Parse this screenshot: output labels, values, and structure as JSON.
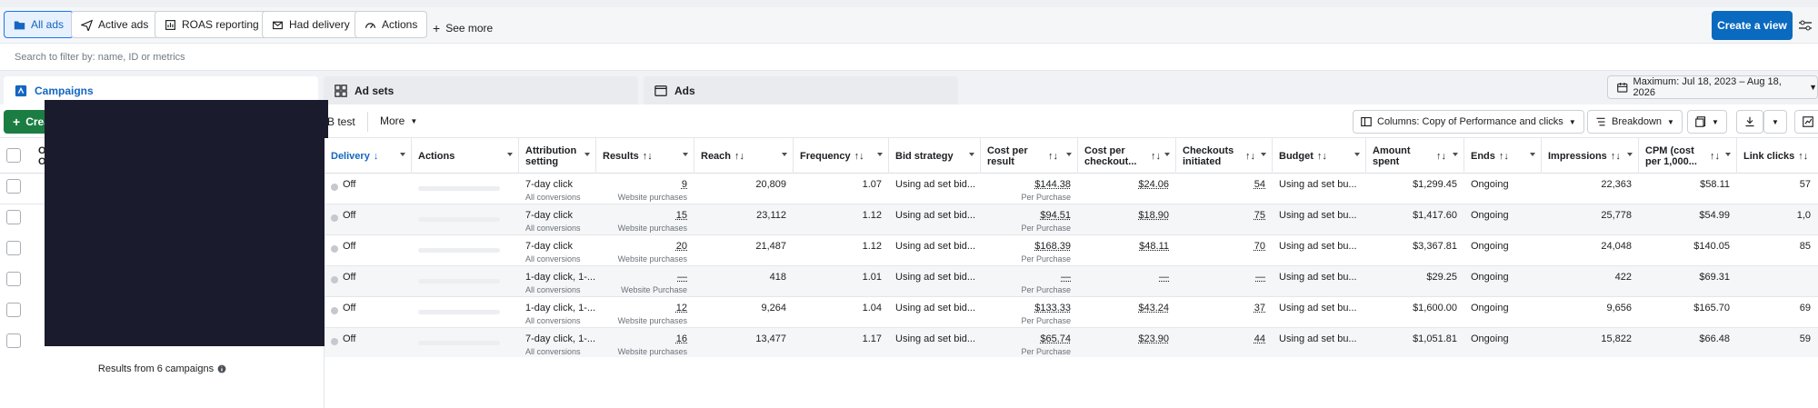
{
  "filters": {
    "chips": [
      {
        "label": "All ads",
        "icon": "folder-icon",
        "active": true
      },
      {
        "label": "Active ads",
        "icon": "send-icon",
        "active": false
      },
      {
        "label": "ROAS reporting",
        "icon": "report-icon",
        "active": false
      },
      {
        "label": "Had delivery",
        "icon": "inbox-icon",
        "active": false
      },
      {
        "label": "Actions",
        "icon": "gauge-icon",
        "active": false
      }
    ],
    "see_more": "See more",
    "create_view": "Create a view"
  },
  "search": {
    "placeholder": "Search to filter by: name, ID or metrics"
  },
  "tabs": {
    "campaigns": "Campaigns",
    "ad_sets": "Ad sets",
    "ads": "Ads"
  },
  "date_range": "Maximum: Jul 18, 2023 – Aug 18, 2026",
  "toolbar": {
    "create": "Crea",
    "ab_test": "B test",
    "more": "More",
    "columns": "Columns: Copy of Performance and clicks",
    "breakdown": "Breakdown"
  },
  "left_panel": {
    "col_header_partial": "O\nO",
    "results_text": "Results from 6 campaigns"
  },
  "columns": [
    {
      "key": "delivery",
      "label": "Delivery",
      "sort": "↓"
    },
    {
      "key": "actions",
      "label": "Actions",
      "sort": ""
    },
    {
      "key": "attribution",
      "label": "Attribution setting",
      "sort": ""
    },
    {
      "key": "results",
      "label": "Results",
      "sort": "↑↓"
    },
    {
      "key": "reach",
      "label": "Reach",
      "sort": "↑↓"
    },
    {
      "key": "frequency",
      "label": "Frequency",
      "sort": "↑↓"
    },
    {
      "key": "bid",
      "label": "Bid strategy",
      "sort": ""
    },
    {
      "key": "cpr",
      "label": "Cost per result",
      "sort": "↑↓"
    },
    {
      "key": "cpc",
      "label": "Cost per checkout...",
      "sort": "↑↓"
    },
    {
      "key": "checkouts",
      "label": "Checkouts initiated",
      "sort": "↑↓"
    },
    {
      "key": "budget",
      "label": "Budget",
      "sort": "↑↓"
    },
    {
      "key": "spent",
      "label": "Amount spent",
      "sort": "↑↓"
    },
    {
      "key": "ends",
      "label": "Ends",
      "sort": "↑↓"
    },
    {
      "key": "impressions",
      "label": "Impressions",
      "sort": "↑↓"
    },
    {
      "key": "cpm",
      "label": "CPM (cost per 1,000...",
      "sort": "↑↓"
    },
    {
      "key": "clicks",
      "label": "Link clicks",
      "sort": "↑↓"
    }
  ],
  "rows": [
    {
      "delivery": "Off",
      "attr": "7-day click",
      "attr_sub": "All conversions",
      "results": "9",
      "results_sub": "Website purchases",
      "reach": "20,809",
      "frequency": "1.07",
      "bid": "Using ad set bid...",
      "cpr": "$144.38",
      "cpr_sub": "Per Purchase",
      "cpc": "$24.06",
      "checkouts": "54",
      "budget": "Using ad set bu...",
      "spent": "$1,299.45",
      "ends": "Ongoing",
      "impressions": "22,363",
      "cpm": "$58.11",
      "clicks": "57"
    },
    {
      "delivery": "Off",
      "attr": "7-day click",
      "attr_sub": "All conversions",
      "results": "15",
      "results_sub": "Website purchases",
      "reach": "23,112",
      "frequency": "1.12",
      "bid": "Using ad set bid...",
      "cpr": "$94.51",
      "cpr_sub": "Per Purchase",
      "cpc": "$18.90",
      "checkouts": "75",
      "budget": "Using ad set bu...",
      "spent": "$1,417.60",
      "ends": "Ongoing",
      "impressions": "25,778",
      "cpm": "$54.99",
      "clicks": "1,0"
    },
    {
      "delivery": "Off",
      "attr": "7-day click",
      "attr_sub": "All conversions",
      "results": "20",
      "results_sub": "Website purchases",
      "reach": "21,487",
      "frequency": "1.12",
      "bid": "Using ad set bid...",
      "cpr": "$168.39",
      "cpr_sub": "Per Purchase",
      "cpc": "$48.11",
      "checkouts": "70",
      "budget": "Using ad set bu...",
      "spent": "$3,367.81",
      "ends": "Ongoing",
      "impressions": "24,048",
      "cpm": "$140.05",
      "clicks": "85"
    },
    {
      "delivery": "Off",
      "attr": "1-day click, 1-...",
      "attr_sub": "All conversions",
      "results": "—",
      "results_sub": "Website Purchase",
      "reach": "418",
      "frequency": "1.01",
      "bid": "Using ad set bid...",
      "cpr": "—",
      "cpr_sub": "Per Purchase",
      "cpc": "—",
      "checkouts": "—",
      "budget": "Using ad set bu...",
      "spent": "$29.25",
      "ends": "Ongoing",
      "impressions": "422",
      "cpm": "$69.31",
      "clicks": ""
    },
    {
      "delivery": "Off",
      "attr": "1-day click, 1-...",
      "attr_sub": "All conversions",
      "results": "12",
      "results_sub": "Website purchases",
      "reach": "9,264",
      "frequency": "1.04",
      "bid": "Using ad set bid...",
      "cpr": "$133.33",
      "cpr_sub": "Per Purchase",
      "cpc": "$43.24",
      "checkouts": "37",
      "budget": "Using ad set bu...",
      "spent": "$1,600.00",
      "ends": "Ongoing",
      "impressions": "9,656",
      "cpm": "$165.70",
      "clicks": "69"
    },
    {
      "delivery": "Off",
      "attr": "7-day click, 1-...",
      "attr_sub": "All conversions",
      "results": "16",
      "results_sub": "Website purchases",
      "reach": "13,477",
      "frequency": "1.17",
      "bid": "Using ad set bid...",
      "cpr": "$65.74",
      "cpr_sub": "Per Purchase",
      "cpc": "$23.90",
      "checkouts": "44",
      "budget": "Using ad set bu...",
      "spent": "$1,051.81",
      "ends": "Ongoing",
      "impressions": "15,822",
      "cpm": "$66.48",
      "clicks": "59"
    }
  ],
  "colors": {
    "accent": "#1877f2",
    "create_green": "#1b7d42",
    "create_view_blue": "#0a6abf"
  }
}
